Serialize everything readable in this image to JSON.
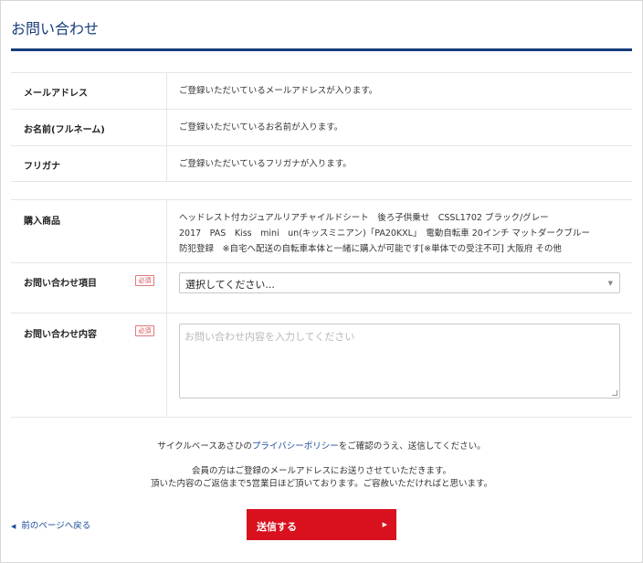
{
  "page": {
    "title": "お問い合わせ"
  },
  "info_rows": [
    {
      "label": "メールアドレス",
      "value": "ご登録いただいているメールアドレスが入ります。"
    },
    {
      "label": "お名前(フルネーム)",
      "value": "ご登録いただいているお名前が入ります。"
    },
    {
      "label": "フリガナ",
      "value": "ご登録いただいているフリガナが入ります。"
    }
  ],
  "product": {
    "label": "購入商品",
    "lines": [
      "ヘッドレスト付カジュアルリアチャイルドシート　後ろ子供乗せ　CSSL1702 ブラック/グレー",
      "2017　PAS　Kiss　mini　un(キッスミニアン)「PA20KXL」　電動自転車 20インチ マットダークブルー",
      "防犯登録　※自宅へ配送の自転車本体と一緒に購入が可能です[※単体での受注不可] 大阪府 その他"
    ]
  },
  "inquiry_item": {
    "label": "お問い合わせ項目",
    "required_badge": "必須",
    "selected_value": "選択してください..."
  },
  "inquiry_content": {
    "label": "お問い合わせ内容",
    "required_badge": "必須",
    "placeholder": "お問い合わせ内容を入力してください"
  },
  "notice": {
    "policy_prefix": "サイクルベースあさひの",
    "policy_link": "プライバシーポリシー",
    "policy_suffix": "をご確認のうえ、送信してください。",
    "line2": "会員の方はご登録のメールアドレスにお送りさせていただきます。",
    "line3": "頂いた内容のご返信まで5営業日ほど頂いております。ご容赦いただければと思います。"
  },
  "actions": {
    "back_label": "前のページへ戻る",
    "submit_label": "送信する"
  },
  "colors": {
    "title": "#173d7a",
    "link": "#1c4f9c",
    "submit_bg": "#d9101e",
    "required": "#d8494f"
  }
}
